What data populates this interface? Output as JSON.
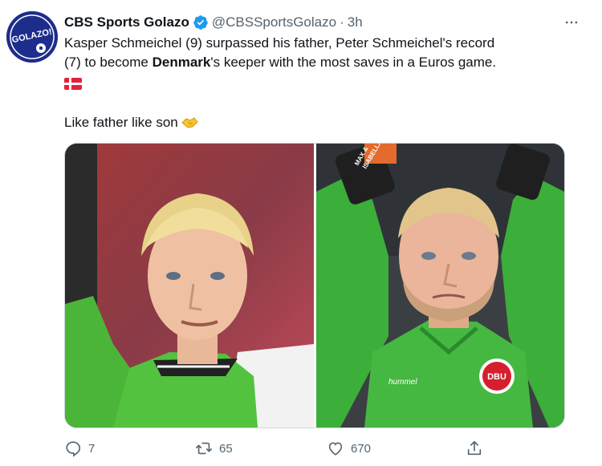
{
  "author": {
    "display_name": "CBS Sports Golazo",
    "handle": "@CBSSportsGolazo",
    "separator": "·",
    "time": "3h",
    "avatar_text": "GOLAZO!",
    "verified_icon": "verified-badge-icon"
  },
  "tweet": {
    "line1": "Kasper Schmeichel (9) surpassed his father, Peter Schmeichel's record",
    "line2_pre": "(7) to become ",
    "line2_bold": "Denmark",
    "line2_post": "'s keeper with the most saves in a Euros game.",
    "flag_icon": "denmark-flag-icon",
    "second_para": "Like father like son",
    "second_para_icon": "handshake-icon"
  },
  "media": {
    "left_image": "peter-schmeichel-photo",
    "right_image": "kasper-schmeichel-photo",
    "glove_text": [
      "MAX &",
      "ISABELLA"
    ],
    "shirt_text": "hummel",
    "crest_text": "DBU"
  },
  "actions": {
    "reply_count": "7",
    "retweet_count": "65",
    "like_count": "670",
    "more_icon": "more-options-icon"
  },
  "colors": {
    "text": "#0f1419",
    "secondary": "#536471",
    "verified": "#1d9bf0",
    "avatar_bg": "#1d2d8c",
    "keeper_green": "#3cae3a"
  }
}
